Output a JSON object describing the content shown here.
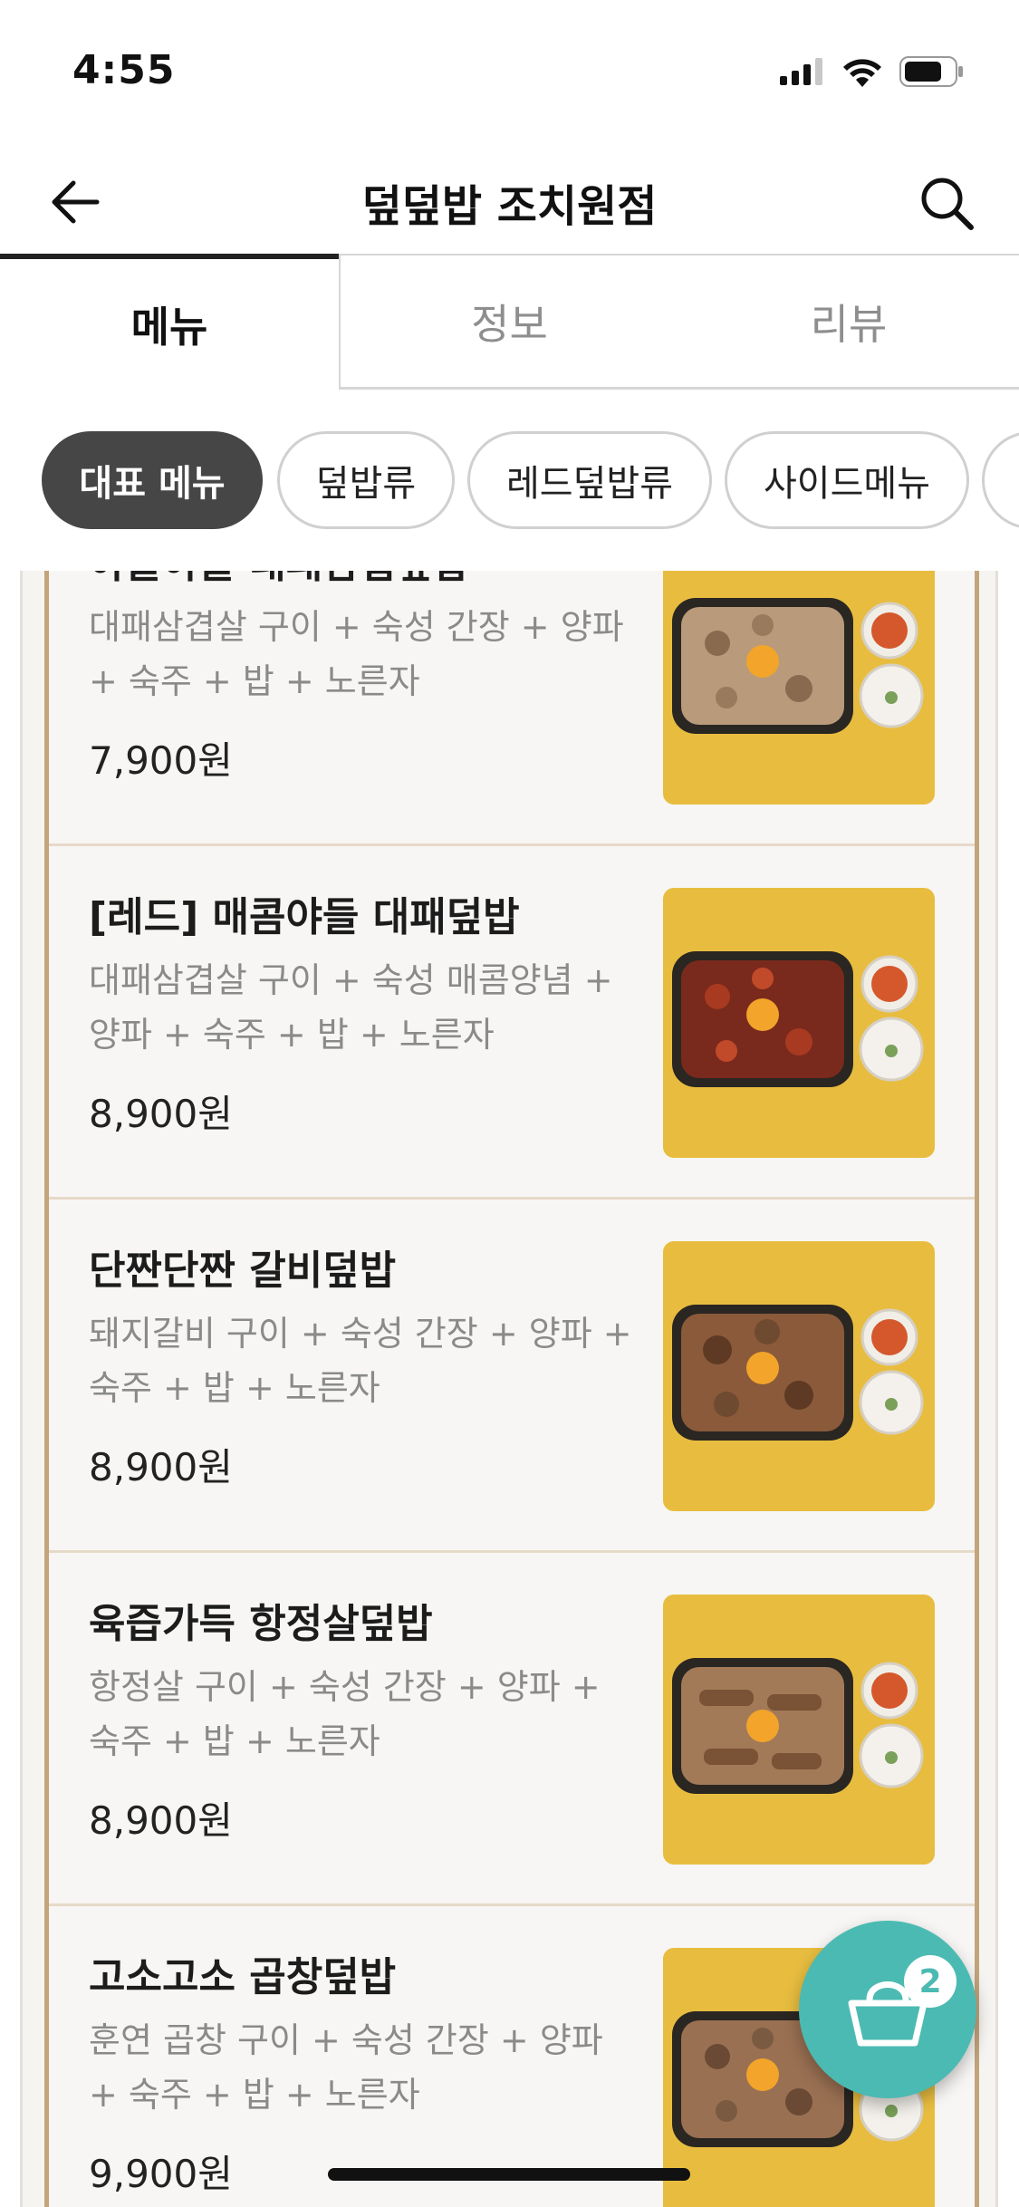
{
  "status_bar": {
    "time": "4:55",
    "icons": [
      "cellular-signal-icon",
      "wifi-icon",
      "battery-icon"
    ]
  },
  "header": {
    "title": "덮덮밥 조치원점",
    "back_icon": "back-arrow-icon",
    "search_icon": "search-icon"
  },
  "tabs": [
    {
      "label": "메뉴",
      "active": true
    },
    {
      "label": "정보",
      "active": false
    },
    {
      "label": "리뷰",
      "active": false
    }
  ],
  "categories": [
    {
      "label": "대표 메뉴",
      "active": true
    },
    {
      "label": "덮밥류",
      "active": false
    },
    {
      "label": "레드덮밥류",
      "active": false
    },
    {
      "label": "사이드메뉴",
      "active": false
    }
  ],
  "menu_items": [
    {
      "name": "야들야들 대패삼겹덮밥",
      "desc": "대패삼겹살 구이 + 숙성 간장 + 양파 + 숙주 + 밥 + 노른자",
      "price": "7,900원"
    },
    {
      "name": "[레드] 매콤야들 대패덮밥",
      "desc": "대패삼겹살 구이 + 숙성 매콤양념 + 양파 + 숙주 + 밥 + 노른자",
      "price": "8,900원"
    },
    {
      "name": "단짠단짠 갈비덮밥",
      "desc": "돼지갈비 구이 + 숙성 간장 + 양파 + 숙주 + 밥 + 노른자",
      "price": "8,900원"
    },
    {
      "name": "육즙가득 항정살덮밥",
      "desc": "항정살 구이 + 숙성 간장 + 양파 + 숙주 + 밥 + 노른자",
      "price": "8,900원"
    },
    {
      "name": "고소고소 곱창덮밥",
      "desc": "훈연 곱창 구이 + 숙성 간장 + 양파 + 숙주 + 밥 + 노른자",
      "price": "9,900원"
    }
  ],
  "cart": {
    "count": "2",
    "icon": "shopping-basket-icon"
  },
  "colors": {
    "accent": "#4bbab2",
    "chip_active": "#464646",
    "photo_bg": "#e8bd3f",
    "frame_border": "#c3a57b"
  }
}
